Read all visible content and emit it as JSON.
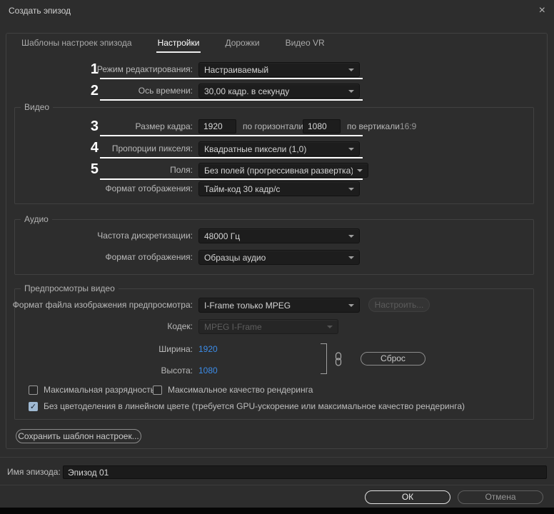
{
  "window": {
    "title": "Создать эпизод"
  },
  "icons": {
    "close": "×",
    "check": "✓"
  },
  "tabs": {
    "presets": "Шаблоны настроек эпизода",
    "settings": "Настройки",
    "tracks": "Дорожки",
    "video_vr": "Видео VR"
  },
  "general": {
    "editing_mode": {
      "label": "Режим редактирования:",
      "value": "Настраиваемый"
    },
    "timebase": {
      "label": "Ось времени:",
      "value": "30,00  кадр. в секунду"
    }
  },
  "video": {
    "legend": "Видео",
    "frame_size": {
      "label": "Размер кадра:",
      "width": "1920",
      "horizontal_label": "по горизонтали",
      "height": "1080",
      "vertical_label": "по вертикали",
      "aspect_ratio": "16:9"
    },
    "pixel_aspect": {
      "label": "Пропорции пикселя:",
      "value": "Квадратные пиксели (1,0)"
    },
    "fields": {
      "label": "Поля:",
      "value": "Без полей (прогрессивная развертка)"
    },
    "display_format": {
      "label": "Формат отображения:",
      "value": "Тайм-код 30 кадр/с"
    }
  },
  "audio": {
    "legend": "Аудио",
    "sample_rate": {
      "label": "Частота дискретизации:",
      "value": "48000 Гц"
    },
    "display_format": {
      "label": "Формат отображения:",
      "value": "Образцы аудио"
    }
  },
  "preview": {
    "legend": "Предпросмотры видео",
    "file_format": {
      "label": "Формат файла изображения предпросмотра:",
      "value": "I-Frame только MPEG"
    },
    "configure_button": "Настроить...",
    "codec": {
      "label": "Кодек:",
      "value": "MPEG I-Frame"
    },
    "width": {
      "label": "Ширина:",
      "value": "1920"
    },
    "height": {
      "label": "Высота:",
      "value": "1080"
    },
    "reset_button": "Сброс",
    "max_bit_depth": {
      "label": "Максимальная разрядность",
      "checked": false
    },
    "max_render_quality": {
      "label": "Максимальное качество рендеринга",
      "checked": false
    },
    "linear_color": {
      "label": "Без цветоделения в линейном цвете (требуется GPU-ускорение или максимальное качество рендеринга)",
      "checked": true
    }
  },
  "save_preset_button": "Сохранить шаблон настроек...",
  "sequence_name": {
    "label": "Имя эпизода:",
    "value": "Эпизод 01"
  },
  "footer": {
    "ok": "ОК",
    "cancel": "Отмена"
  },
  "annotations": {
    "n1": "1",
    "n2": "2",
    "n3": "3",
    "n4": "4",
    "n5": "5"
  },
  "colors": {
    "value_blue": "#3c8ce8",
    "annotation_white": "#ffffff",
    "background": "#2d2d2d"
  }
}
